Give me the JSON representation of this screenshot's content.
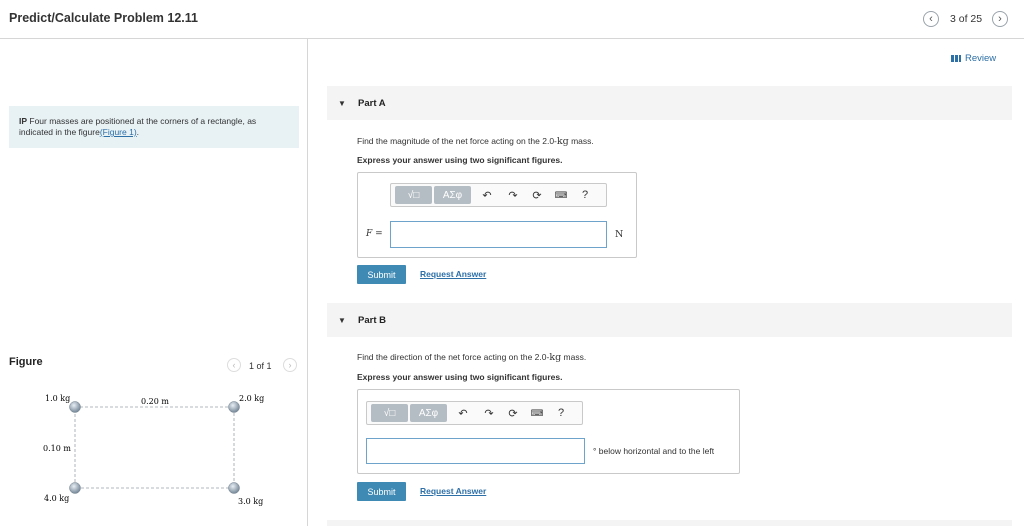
{
  "header": {
    "title": "Predict/Calculate Problem 12.11",
    "page_count": "3 of 25",
    "prev_icon": "chevron-left-icon",
    "next_icon": "chevron-right-icon"
  },
  "problem": {
    "prefix": "IP",
    "text": " Four masses are positioned at the corners of a rectangle, as indicated in the figure",
    "link_text": "(Figure 1)",
    "suffix": "."
  },
  "figure": {
    "label": "Figure",
    "count": "1 of 1",
    "masses": {
      "top_left": "1.0 kg",
      "top_right": "2.0 kg",
      "bottom_left": "4.0 kg",
      "bottom_right": "3.0 kg"
    },
    "width_label": "0.20 m",
    "height_label": "0.10 m"
  },
  "review": {
    "label": "Review",
    "icon": "review-bars-icon"
  },
  "parts": [
    {
      "label": "Part A",
      "question_pre": "Find the magnitude of the net force acting on the 2.0-",
      "question_unit": "kg",
      "question_post": " mass.",
      "instruction": "Express your answer using two significant figures.",
      "var_label": "F =",
      "unit": "N",
      "input_value": "",
      "submit": "Submit",
      "request": "Request Answer"
    },
    {
      "label": "Part B",
      "question_pre": "Find the direction of the net force acting on the 2.0-",
      "question_unit": "kg",
      "question_post": " mass.",
      "instruction": "Express your answer using two significant figures.",
      "unit": "° below horizontal and to the left",
      "input_value": "",
      "submit": "Submit",
      "request": "Request Answer"
    }
  ],
  "toolbar": {
    "template_label": "√□",
    "greek_label": "ΑΣφ",
    "help_label": "?"
  },
  "colors": {
    "accent": "#3f8ab4",
    "link": "#2d6fa7",
    "problem_bg": "#e8f2f5"
  }
}
